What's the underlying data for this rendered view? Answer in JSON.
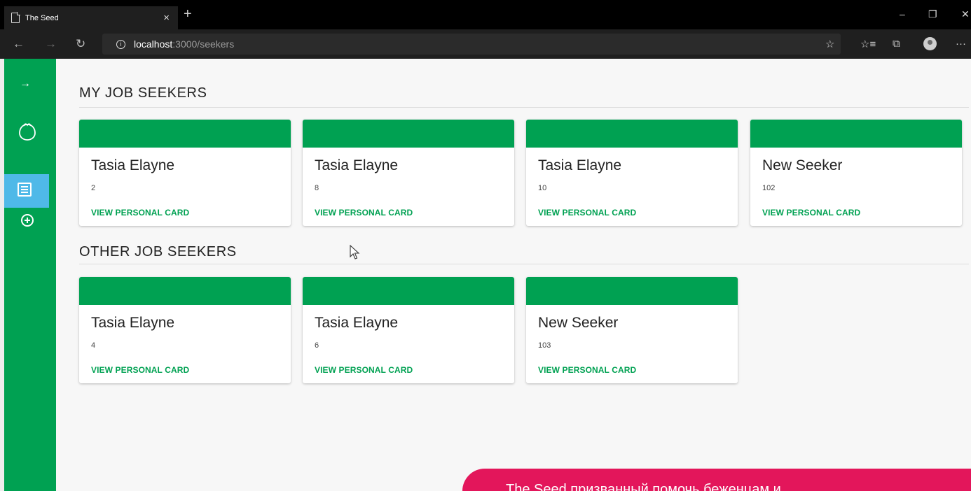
{
  "browser": {
    "tab_title": "The Seed",
    "tab_close": "×",
    "new_tab": "+",
    "address_host": "localhost",
    "address_path": ":3000/seekers",
    "win_min": "–",
    "win_max": "❐",
    "win_close": "✕"
  },
  "nav": {
    "back": "←",
    "forward": "→",
    "refresh": "↻",
    "more": "···",
    "star": "☆",
    "favorites": "☆≡",
    "collections": "⧉"
  },
  "sidebar": {
    "collapse_glyph": "→"
  },
  "sections": {
    "my_title": "MY JOB SEEKERS",
    "other_title": "OTHER JOB SEEKERS"
  },
  "my_seekers": [
    {
      "name": "Tasia Elayne",
      "id": "2",
      "link": "VIEW PERSONAL CARD"
    },
    {
      "name": "Tasia Elayne",
      "id": "8",
      "link": "VIEW PERSONAL CARD"
    },
    {
      "name": "Tasia Elayne",
      "id": "10",
      "link": "VIEW PERSONAL CARD"
    },
    {
      "name": "New Seeker",
      "id": "102",
      "link": "VIEW PERSONAL CARD"
    }
  ],
  "other_seekers": [
    {
      "name": "Tasia Elayne",
      "id": "4",
      "link": "VIEW PERSONAL CARD"
    },
    {
      "name": "Tasia Elayne",
      "id": "6",
      "link": "VIEW PERSONAL CARD"
    },
    {
      "name": "New Seeker",
      "id": "103",
      "link": "VIEW PERSONAL CARD"
    }
  ],
  "overlay": {
    "text": "The Seed призванный помочь беженцам и"
  },
  "colors": {
    "brand_green": "#00a152",
    "active_blue": "#4fb9e8",
    "overlay_pink": "#e3165b"
  }
}
